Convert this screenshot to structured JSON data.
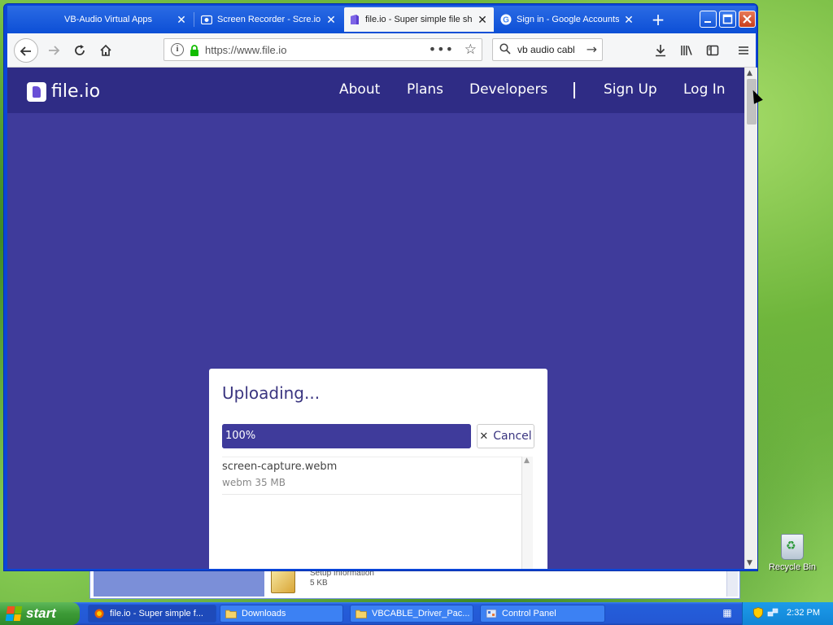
{
  "browser": {
    "tabs": [
      {
        "title": "VB-Audio Virtual Apps",
        "favicon": "none-icon",
        "active": false
      },
      {
        "title": "Screen Recorder - Scre.io",
        "favicon": "camera-icon",
        "active": false
      },
      {
        "title": "file.io - Super simple file sh",
        "favicon": "fileio-icon",
        "active": true
      },
      {
        "title": "Sign in - Google Accounts",
        "favicon": "google-icon",
        "active": false
      }
    ],
    "url": "https://www.file.io",
    "search_value": "vb audio cabl",
    "window_controls": {
      "minimize": "_",
      "maximize": "□",
      "close": "✕"
    }
  },
  "site": {
    "logo_text": "file.io",
    "nav": {
      "about": "About",
      "plans": "Plans",
      "developers": "Developers",
      "signup": "Sign Up",
      "login": "Log In"
    },
    "background_color": "#3f3b9b",
    "header_color": "#2f2c85"
  },
  "upload_modal": {
    "title": "Uploading...",
    "progress_label": "100%",
    "progress_value": 1.0,
    "cancel_label": "Cancel",
    "files": [
      {
        "name": "screen-capture.webm",
        "meta": "webm 35 MB"
      }
    ]
  },
  "background_window": {
    "file_name": "Setup Information",
    "file_size": "5 KB"
  },
  "desktop": {
    "recycle_bin_label": "Recycle Bin"
  },
  "taskbar": {
    "start_label": "start",
    "tasks": [
      {
        "label": "file.io - Super simple f...",
        "icon": "firefox-icon",
        "active": true
      },
      {
        "label": "Downloads",
        "icon": "folder-icon",
        "active": false
      },
      {
        "label": "VBCABLE_Driver_Pac...",
        "icon": "folder-icon",
        "active": false
      },
      {
        "label": "Control Panel",
        "icon": "control-panel-icon",
        "active": false
      }
    ],
    "clock": "2:32 PM"
  }
}
